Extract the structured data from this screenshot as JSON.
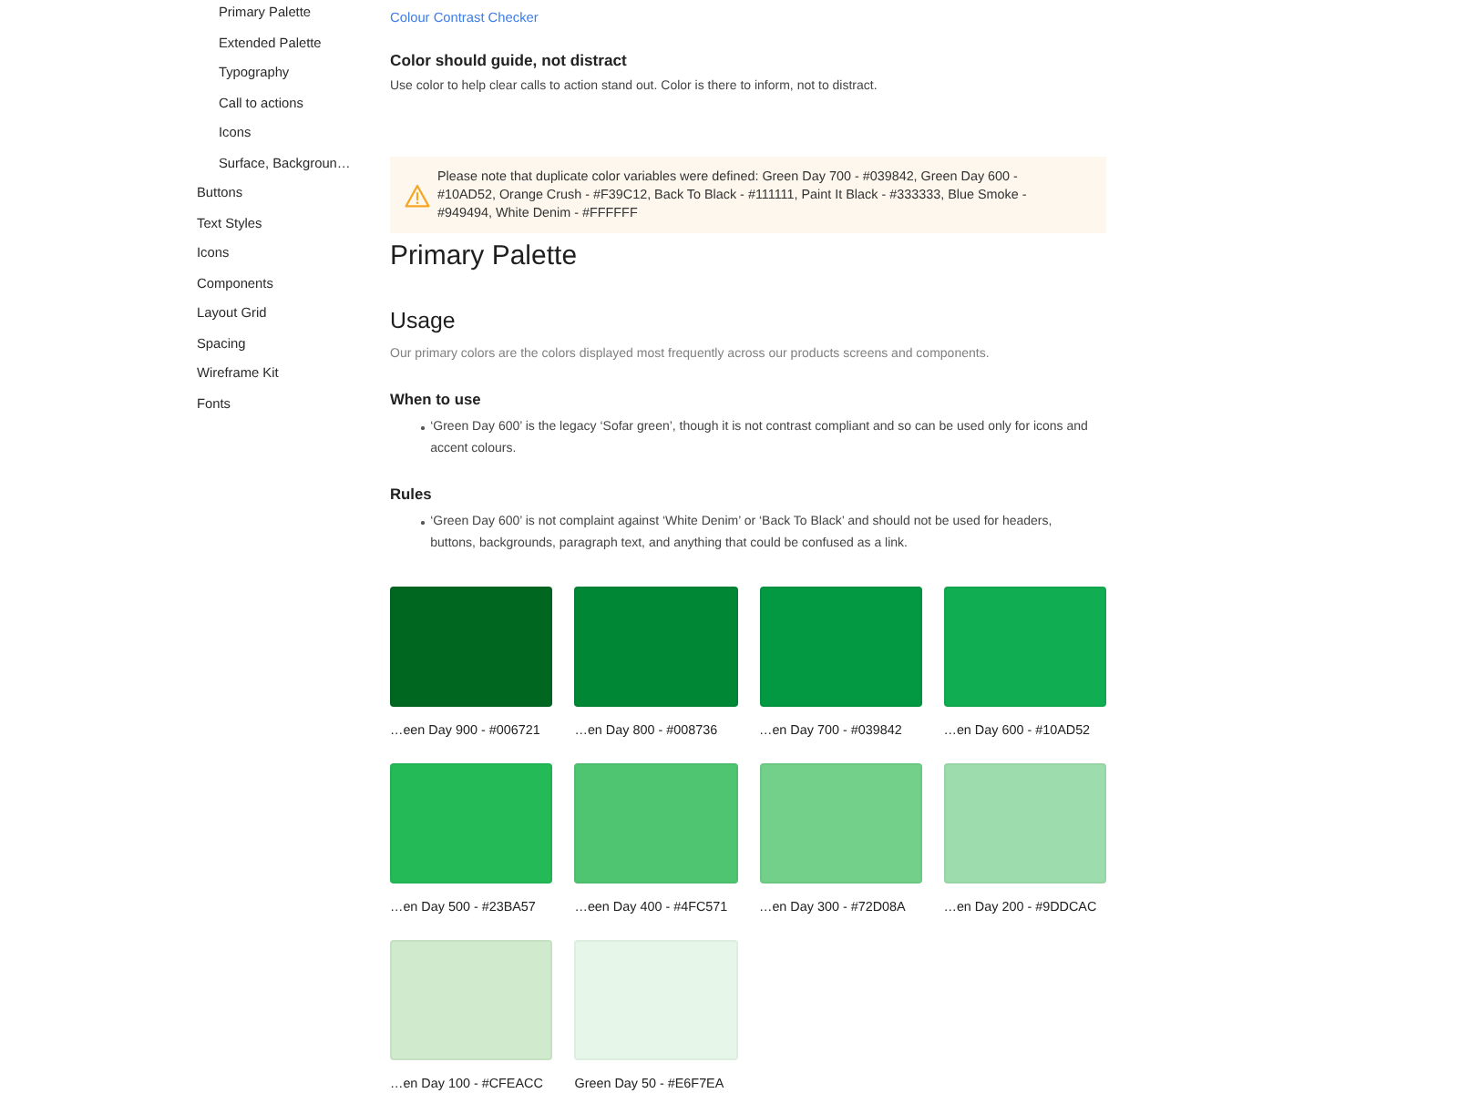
{
  "sidebar": {
    "items": [
      {
        "children": [
          {
            "label": "Primary Palette"
          },
          {
            "label": "Extended Palette"
          },
          {
            "label": "Typography"
          },
          {
            "label": "Call to actions"
          },
          {
            "label": "Icons"
          },
          {
            "label": "Surface, Backgroun…"
          }
        ]
      },
      {
        "label": "Buttons"
      },
      {
        "label": "Text Styles"
      },
      {
        "label": "Icons"
      },
      {
        "label": "Components"
      },
      {
        "label": "Layout Grid"
      },
      {
        "label": "Spacing"
      },
      {
        "label": "Wireframe Kit"
      },
      {
        "label": "Fonts"
      }
    ]
  },
  "link": "Colour Contrast Checker",
  "intro": {
    "heading": "Color should guide, not distract",
    "text": "Use color to help clear calls to action stand out. Color is there to inform, not to distract."
  },
  "notice": {
    "kind": "warning",
    "text": "Please note that duplicate color variables were defined: Green Day 700 - #039842, Green Day 600 - #10AD52, Orange Crush - #F39C12, Back To Black - #111111, Paint It Black - #333333, Blue Smoke - #949494, White Denim - #FFFFFF"
  },
  "title": "Primary Palette",
  "usage": {
    "heading": "Usage",
    "text": "Our primary colors are the colors displayed most frequently across our products screens and components.",
    "sections": [
      {
        "heading": "When to use",
        "bullets": [
          "‘Green Day 600’ is the legacy ‘Sofar green’, though it is not contrast compliant and so can be used only for icons and accent colours."
        ]
      },
      {
        "heading": "Rules",
        "bullets": [
          "‘Green Day 600’ is not complaint against ‘White Denim’ or ‘Back To Black’ and should not be used for headers, buttons, backgrounds, paragraph text, and anything that could be confused as a link."
        ]
      }
    ]
  },
  "swatches": [
    {
      "label": "…een Day 900 - #006721",
      "color": "#006721"
    },
    {
      "label": "…en Day 800 - #008736",
      "color": "#008736"
    },
    {
      "label": "…en Day 700 - #039842",
      "color": "#039842"
    },
    {
      "label": "…en Day 600 - #10AD52",
      "color": "#10AD52"
    },
    {
      "label": "…en Day 500 - #23BA57",
      "color": "#23BA57"
    },
    {
      "label": "…een Day 400 - #4FC571",
      "color": "#4FC571"
    },
    {
      "label": "…en Day 300 - #72D08A",
      "color": "#72D08A"
    },
    {
      "label": "…en Day 200 - #9DDCAC",
      "color": "#9DDCAC"
    },
    {
      "label": "…en Day 100 - #CFEACC",
      "color": "#CFEACC"
    },
    {
      "label": "Green Day 50 - #E6F7EA",
      "color": "#E6F7EA"
    }
  ]
}
